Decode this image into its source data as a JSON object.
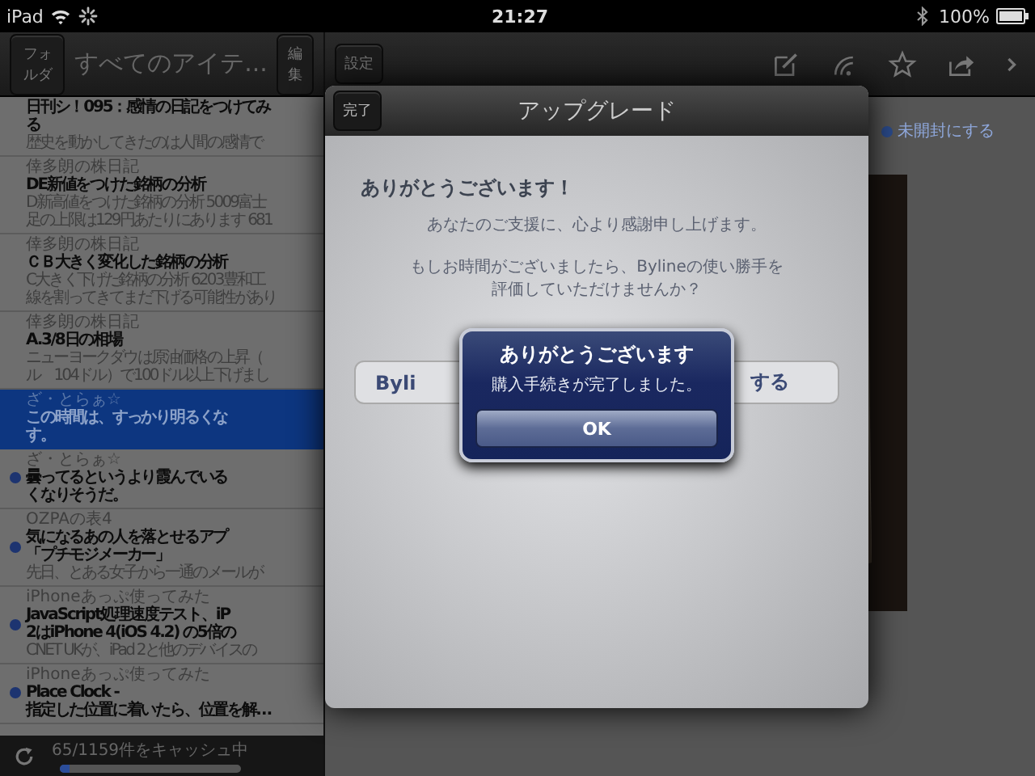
{
  "status_bar": {
    "device": "iPad",
    "time": "21:27",
    "battery": "100%"
  },
  "sidebar": {
    "back_button": "フォルダ",
    "title": "すべてのアイテ...",
    "edit_button": "編集",
    "items": [
      {
        "title": [
          "日刊シ！095：感情の日記をつけてみ",
          "る"
        ],
        "snippet": [
          "歴史を動かしてきたのは人間の感情で"
        ],
        "unread": false,
        "selected": false
      },
      {
        "source": "倖多朗の株日記",
        "title": [
          "DE新値をつけた銘柄の分析"
        ],
        "snippet": [
          "D新高値をつけた銘柄の分析 5009富士",
          "足の上限は129円あたりにあります 681"
        ],
        "unread": false,
        "selected": false
      },
      {
        "source": "倖多朗の株日記",
        "title": [
          "ＣＢ大きく変化した銘柄の分析"
        ],
        "snippet": [
          "C大きく下げた銘柄の分析 6203豊和工",
          "線を割ってきてまだ下げる可能性があり"
        ],
        "unread": false,
        "selected": false
      },
      {
        "source": "倖多朗の株日記",
        "title": [
          "A.3/8日の相場"
        ],
        "snippet": [
          "ニューヨークダウは原油価格の上昇（",
          "ル　104ドル）で100ドル以上下げまし"
        ],
        "unread": false,
        "selected": false
      },
      {
        "source": "ざ・とらぁ☆",
        "title": [
          "この時間は、すっかり明るくな",
          "す。"
        ],
        "unread": false,
        "selected": true
      },
      {
        "source": "ざ・とらぁ☆",
        "title": [
          "曇ってるというより霞んでいる",
          "くなりそうだ。"
        ],
        "unread": true,
        "selected": false
      },
      {
        "source": "OZPAの表4",
        "title": [
          "気になるあの人を落とせるアプ",
          "「プチモジメーカー」"
        ],
        "snippet": [
          "先日、とある女子から一通のメールが"
        ],
        "unread": true,
        "selected": false
      },
      {
        "source": "iPhoneあっぷ使ってみた",
        "title": [
          "JavaScript処理速度テスト、iP",
          "2はiPhone 4(iOS 4.2) の5倍の"
        ],
        "snippet": [
          "CNET UKが、iPad 2と他のデバイスの"
        ],
        "unread": true,
        "selected": false
      },
      {
        "source": "iPhoneあっぷ使ってみた",
        "title": [
          "Place Clock -",
          "指定した位置に着いたら、位置を解…"
        ],
        "unread": true,
        "selected": false
      }
    ],
    "cache_status": "65/1159件をキャッシュ中",
    "cache_progress": {
      "level": 0.06
    }
  },
  "article": {
    "settings_button": "設定",
    "mark_unread": "未開封にする"
  },
  "upgrade_dialog": {
    "title": "アップグレード",
    "done_button": "完了",
    "heading": "ありがとうございます！",
    "message": "あなたのご支援に、心より感謝申し上げます。",
    "question": "もしお時間がございましたら、Bylineの使い勝手を評価していただけませんか？",
    "rate_button": {
      "visible_start": "Byli",
      "visible_end": "する"
    }
  },
  "alert": {
    "title": "ありがとうございます",
    "message": "購入手続きが完了しました。",
    "ok_button": "OK"
  }
}
